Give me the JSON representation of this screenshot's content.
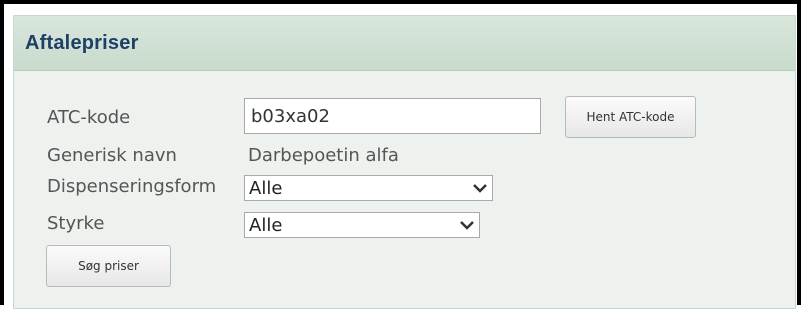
{
  "panel": {
    "title": "Aftalepriser"
  },
  "form": {
    "atc_label": "ATC-kode",
    "atc_value": "b03xa02",
    "fetch_button": "Hent ATC-kode",
    "generic_label": "Generisk navn",
    "generic_value": "Darbepoetin alfa",
    "dispensing_label": "Dispenseringsform",
    "dispensing_value": "Alle",
    "strength_label": "Styrke",
    "strength_value": "Alle",
    "search_button": "Søg priser"
  },
  "icons": {
    "dropdown": "chevron-down-icon"
  }
}
